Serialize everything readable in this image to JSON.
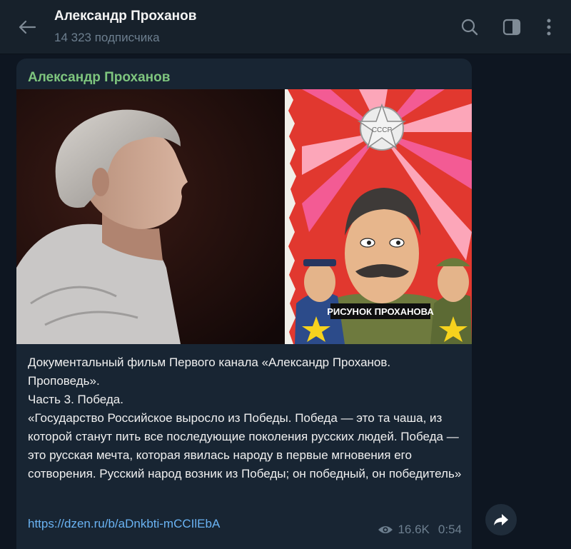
{
  "header": {
    "title": "Александр Проханов",
    "subscribers": "14 323 подписчика"
  },
  "post": {
    "author": "Александр Проханов",
    "image_caption": "РИСУНОК ПРОХАНОВА",
    "badge_text": "СССР",
    "lines": [
      "Документальный фильм Первого канала «Александр Проханов. Проповедь».",
      "Часть 3. Победа.",
      "«Государство Российское выросло из Победы. Победа — это та чаша, из которой станут пить все последующие поколения русских людей. Победа — это русская мечта, которая явилась народу в первые мгновения его сотворения. Русский народ возник из Победы; он победный, он победитель»"
    ],
    "link": "https://dzen.ru/b/aDnkbti-mCCIlEbA",
    "views": "16.6K",
    "time": "0:54"
  },
  "colors": {
    "header_bg": "#17212b",
    "chat_bg": "#0e1621",
    "bubble_bg": "#182533",
    "author": "#7ec57e",
    "link": "#6ab3f3",
    "muted": "#6d7f8f"
  },
  "icons": {
    "back": "arrow-left-icon",
    "search": "search-icon",
    "sidebar": "sidebar-toggle-icon",
    "more": "more-vertical-icon",
    "views": "eye-icon",
    "share": "share-icon"
  }
}
